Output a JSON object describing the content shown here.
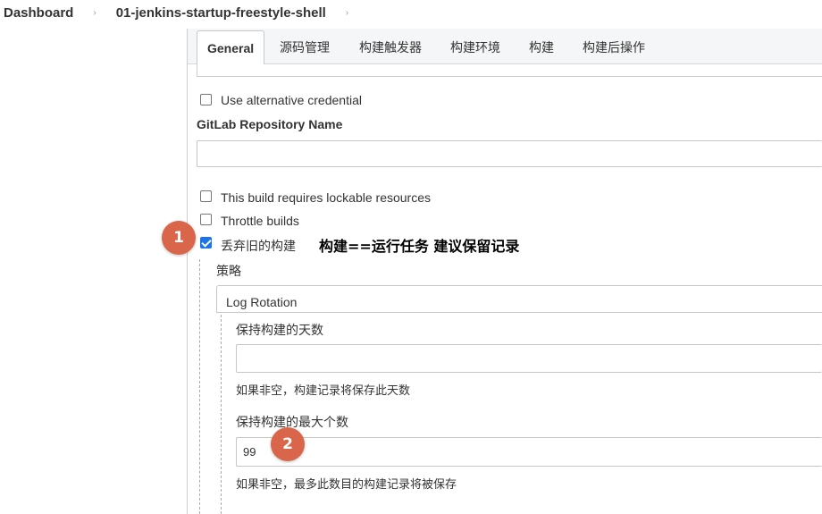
{
  "breadcrumb": {
    "items": [
      "Dashboard",
      "01-jenkins-startup-freestyle-shell"
    ],
    "separator": "›"
  },
  "tabs": [
    {
      "label": "General",
      "active": true
    },
    {
      "label": "源码管理",
      "active": false
    },
    {
      "label": "构建触发器",
      "active": false
    },
    {
      "label": "构建环境",
      "active": false
    },
    {
      "label": "构建",
      "active": false
    },
    {
      "label": "构建后操作",
      "active": false
    }
  ],
  "options": {
    "alt_credential": {
      "label": "Use alternative credential",
      "checked": false
    },
    "gitlab_repo_name": {
      "label": "GitLab Repository Name",
      "value": ""
    },
    "lockable_resources": {
      "label": "This build requires lockable resources",
      "checked": false
    },
    "throttle_builds": {
      "label": "Throttle builds",
      "checked": false
    },
    "discard_old_builds": {
      "label": "丢弃旧的构建",
      "checked": true
    }
  },
  "strategy": {
    "label": "策略",
    "selected": "Log Rotation"
  },
  "log_rotation": {
    "days_label": "保持构建的天数",
    "days_value": "",
    "days_help": "如果非空，构建记录将保存此天数",
    "max_label": "保持构建的最大个数",
    "max_value": "99",
    "max_help": "如果非空，最多此数目的构建记录将被保存"
  },
  "annotations": {
    "badge1": "1",
    "badge2": "2",
    "note": "构建==运行任务  建议保留记录"
  },
  "colors": {
    "badge": "#d9654a",
    "checkbox_checked": "#1a73e8",
    "tab_bar": "#f5f6f7"
  }
}
